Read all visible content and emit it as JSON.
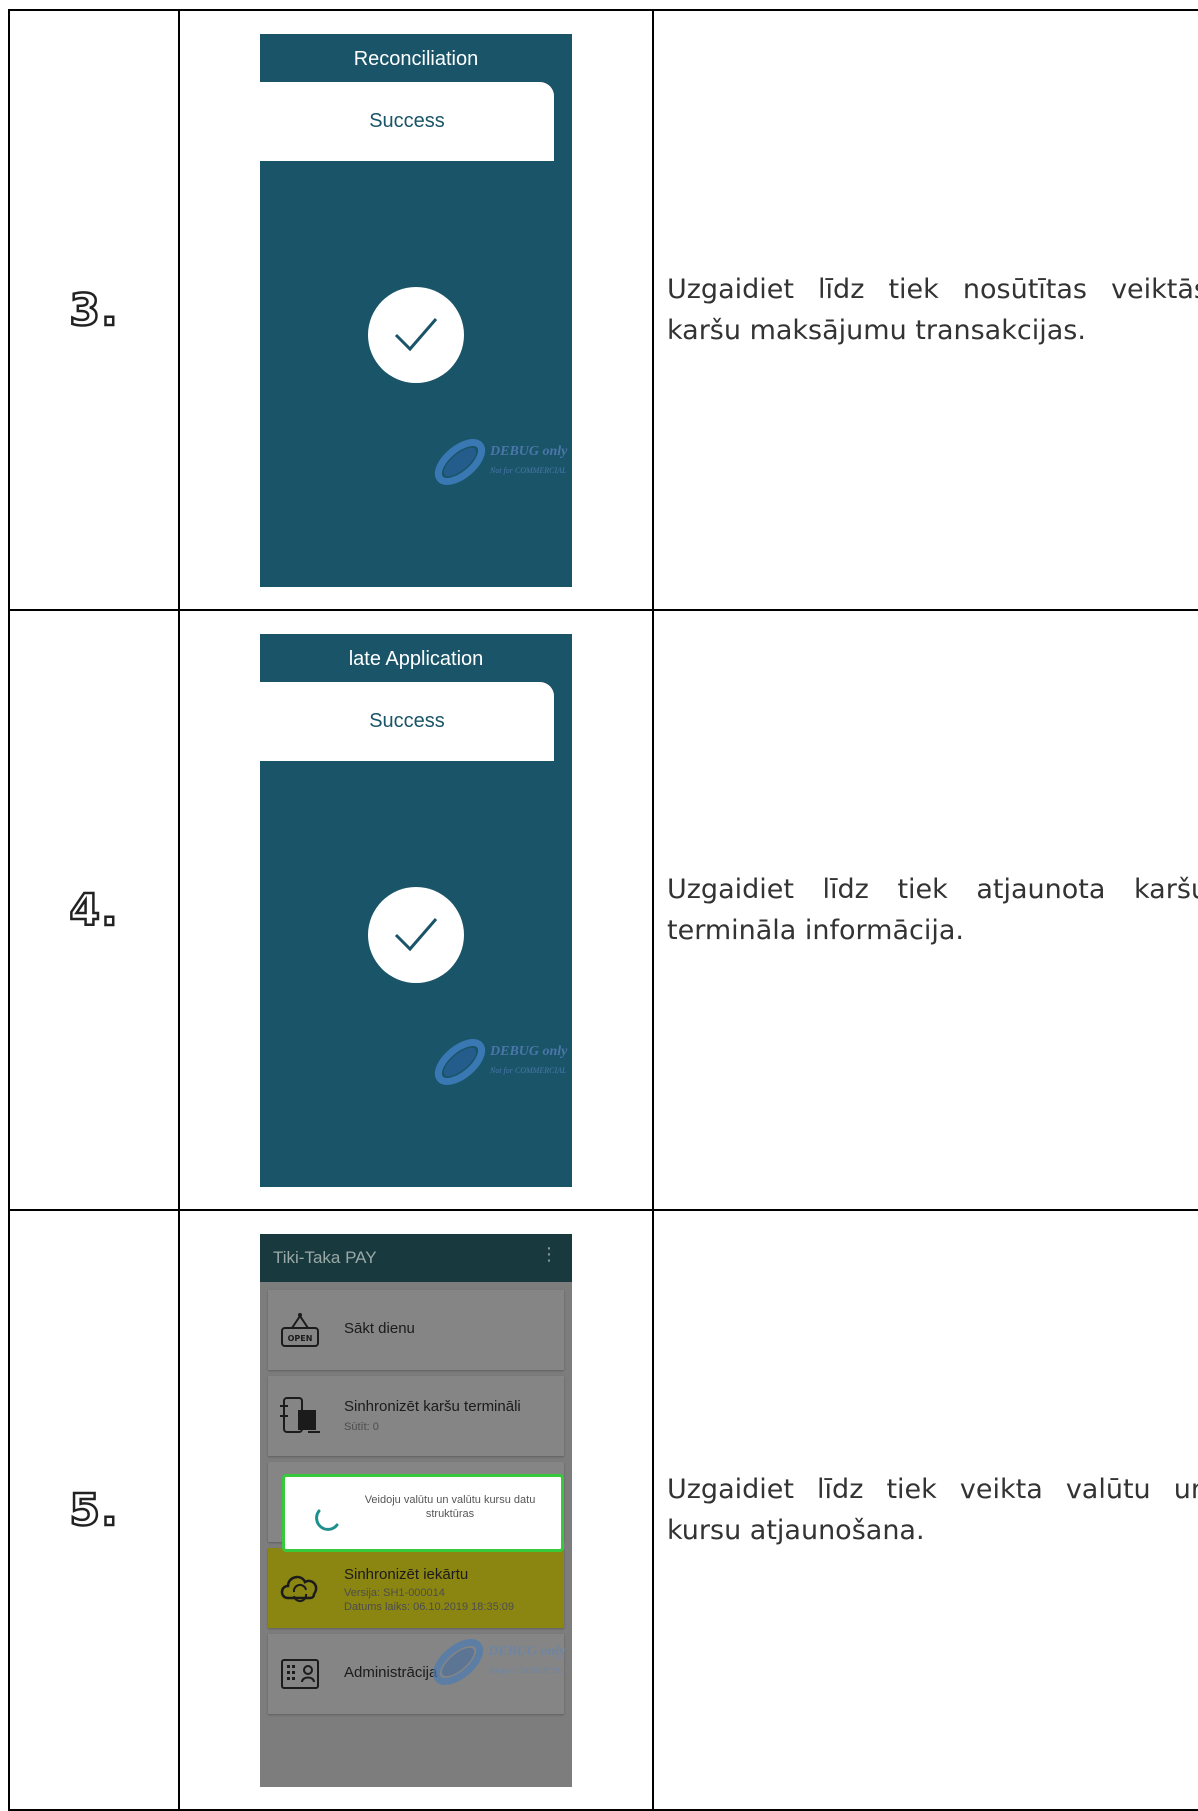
{
  "rows": [
    {
      "number": "3.",
      "screen": {
        "title": "Reconciliation",
        "status": "Success",
        "icon": "check-icon",
        "watermark": "DEBUG only",
        "watermark_sub": "Not for COMMERCIAL"
      },
      "description": "Uzgaidiet līdz tiek nosūtītas veiktās karšu maksājumu transakcijas."
    },
    {
      "number": "4.",
      "screen": {
        "title": "late Application",
        "status": "Success",
        "icon": "check-icon",
        "watermark": "DEBUG only",
        "watermark_sub": "Not for COMMERCIAL"
      },
      "description": "Uzgaidiet līdz tiek atjaunota karšu termināla informācija."
    },
    {
      "number": "5.",
      "screen": {
        "app_title": "Tiki-Taka PAY",
        "menu_icon": "more-vert-icon",
        "items": [
          {
            "label": "Sākt dienu",
            "icon": "open-sign-icon"
          },
          {
            "label": "Sinhronizēt karšu termināli",
            "sub": "Sūtīt: 0",
            "icon": "terminal-sync-icon"
          },
          {
            "label": "Sinhronizēt iekārtu",
            "sub": "Versija: SH1-000014",
            "sub2": "Datums laiks: 06.10.2019 18:35:09",
            "icon": "cloud-sync-icon",
            "highlight": "#8b8512"
          },
          {
            "label": "Administrācija",
            "icon": "admin-icon"
          }
        ],
        "dialog_text": "Veidoju valūtu un valūtu kursu datu struktūras",
        "watermark": "DEBUG only",
        "watermark_sub": "Not for COMMERCIAL"
      },
      "description": "Uzgaidiet līdz tiek veikta valūtu un kursu atjaunošana."
    }
  ],
  "colors": {
    "teal": "#195468",
    "app_bar": "#183a3e",
    "dialog_border": "#37c83b"
  }
}
